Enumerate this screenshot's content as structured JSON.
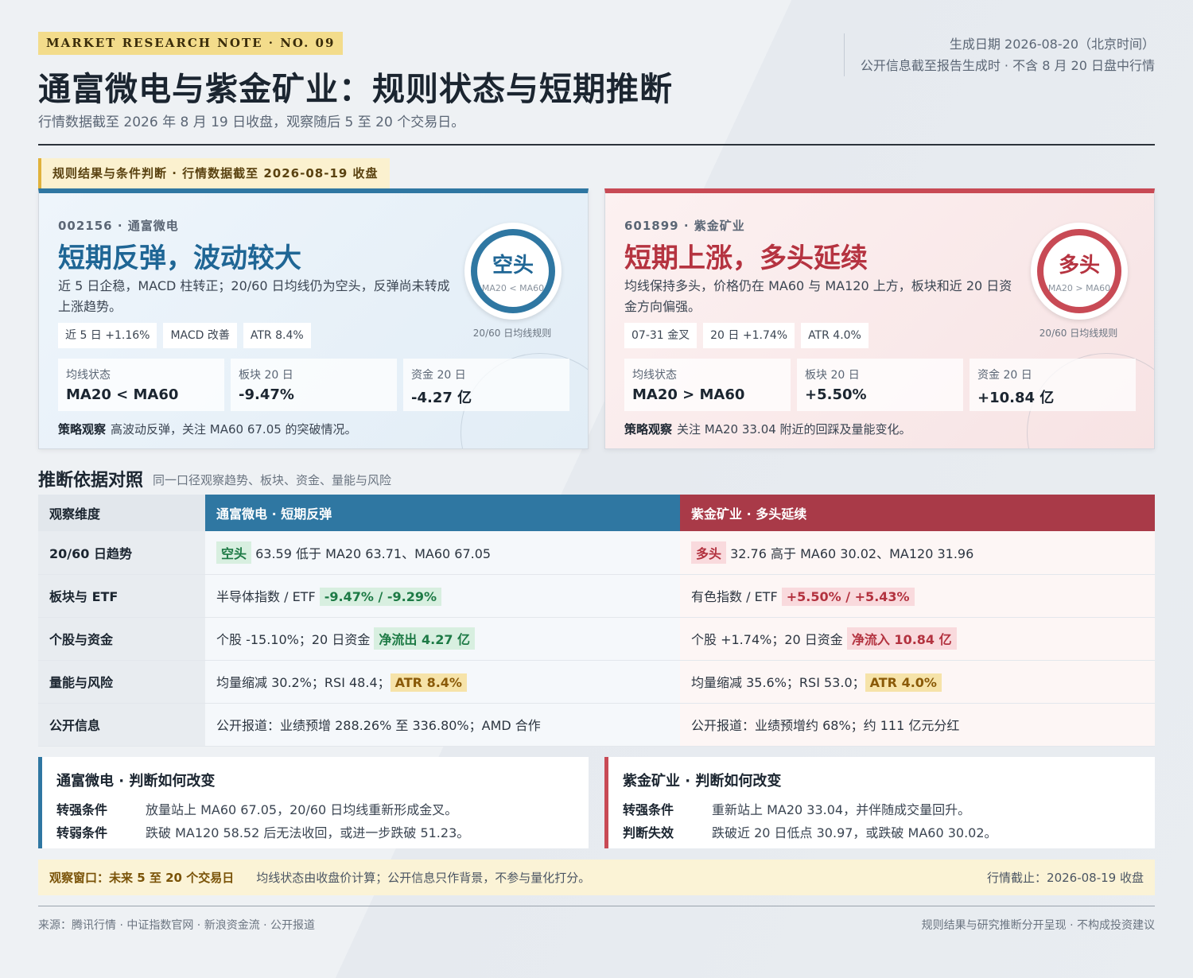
{
  "header": {
    "tag": "MARKET RESEARCH NOTE · NO. 09",
    "title": "通富微电与紫金矿业：规则状态与短期推断",
    "subtitle": "行情数据截至 2026 年 8 月 19 日收盘，观察随后 5 至 20 个交易日。",
    "generated": "生成日期 2026-08-20（北京时间）",
    "cutoff_note": "公开信息截至报告生成时 · 不含 8 月 20 日盘中行情"
  },
  "section_tag": "规则结果与条件判断 · 行情数据截至 2026-08-19 收盘",
  "colors": {
    "blue": "#2f77a2",
    "red": "#c84a55",
    "amber": "#e0b23b"
  },
  "cards": [
    {
      "code": "002156 · 通富微电",
      "headline": "短期反弹，波动较大",
      "desc": "近 5 日企稳，MACD 柱转正；20/60 日均线仍为空头，反弹尚未转成上涨趋势。",
      "chips": [
        "近 5 日 +1.16%",
        "MACD 改善",
        "ATR 8.4%"
      ],
      "badge_word": "空头",
      "badge_sub": "MA20 < MA60",
      "badge_note": "20/60 日均线规则",
      "stats": [
        {
          "k": "均线状态",
          "v": "MA20 < MA60"
        },
        {
          "k": "板块 20 日",
          "v": "-9.47%"
        },
        {
          "k": "资金 20 日",
          "v": "-4.27 亿"
        }
      ],
      "strategy_label": "策略观察",
      "strategy": "高波动反弹，关注 MA60 67.05 的突破情况。"
    },
    {
      "code": "601899 · 紫金矿业",
      "headline": "短期上涨，多头延续",
      "desc": "均线保持多头，价格仍在 MA60 与 MA120 上方，板块和近 20 日资金方向偏强。",
      "chips": [
        "07-31 金叉",
        "20 日 +1.74%",
        "ATR 4.0%"
      ],
      "badge_word": "多头",
      "badge_sub": "MA20 > MA60",
      "badge_note": "20/60 日均线规则",
      "stats": [
        {
          "k": "均线状态",
          "v": "MA20 > MA60"
        },
        {
          "k": "板块 20 日",
          "v": "+5.50%"
        },
        {
          "k": "资金 20 日",
          "v": "+10.84 亿"
        }
      ],
      "strategy_label": "策略观察",
      "strategy": "关注 MA20 33.04 附近的回踩及量能变化。"
    }
  ],
  "comparison": {
    "title": "推断依据对照",
    "subtitle": "同一口径观察趋势、板块、资金、量能与风险",
    "headers": [
      "观察维度",
      "通富微电 · 短期反弹",
      "紫金矿业 · 多头延续"
    ],
    "rows": [
      {
        "dim": "20/60 日趋势",
        "b_pre": "",
        "b_hl": "空头",
        "b_post": " 63.59 低于 MA20 63.71、MA60 67.05",
        "r_pre": "",
        "r_hl": "多头",
        "r_post": " 32.76 高于 MA60 30.02、MA120 31.96"
      },
      {
        "dim": "板块与 ETF",
        "b_pre": "半导体指数 / ETF ",
        "b_hl": "-9.47% / -9.29%",
        "b_post": "",
        "r_pre": "有色指数 / ETF ",
        "r_hl": "+5.50% / +5.43%",
        "r_post": ""
      },
      {
        "dim": "个股与资金",
        "b_pre": "个股 -15.10%；20 日资金 ",
        "b_hl": "净流出 4.27 亿",
        "b_post": "",
        "r_pre": "个股 +1.74%；20 日资金 ",
        "r_hl": "净流入 10.84 亿",
        "r_post": ""
      },
      {
        "dim": "量能与风险",
        "b_pre": "均量缩减 30.2%；RSI 48.4；",
        "b_hl": "ATR 8.4%",
        "b_post": "",
        "r_pre": "均量缩减 35.6%；RSI 53.0；",
        "r_hl": "ATR 4.0%",
        "r_post": ""
      },
      {
        "dim": "公开信息",
        "b_pre": "公开报道：业绩预增 288.26% 至 336.80%；AMD 合作",
        "b_hl": "",
        "b_post": "",
        "r_pre": "公开报道：业绩预增约 68%；约 111 亿元分红",
        "r_hl": "",
        "r_post": ""
      }
    ]
  },
  "changes": [
    {
      "title": "通富微电 · 判断如何改变",
      "rows": [
        {
          "k": "转强条件",
          "v": "放量站上 MA60 67.05，20/60 日均线重新形成金叉。"
        },
        {
          "k": "转弱条件",
          "v": "跌破 MA120 58.52 后无法收回，或进一步跌破 51.23。"
        }
      ]
    },
    {
      "title": "紫金矿业 · 判断如何改变",
      "rows": [
        {
          "k": "转强条件",
          "v": "重新站上 MA20 33.04，并伴随成交量回升。"
        },
        {
          "k": "判断失效",
          "v": "跌破近 20 日低点 30.97，或跌破 MA60 30.02。"
        }
      ]
    }
  ],
  "window": {
    "label": "观察窗口：未来 5 至 20 个交易日",
    "desc": "均线状态由收盘价计算；公开信息只作背景，不参与量化打分。",
    "right": "行情截止：2026-08-19 收盘"
  },
  "footer": {
    "sources": "来源：腾讯行情 · 中证指数官网 · 新浪资金流 · 公开报道",
    "disclaimer": "规则结果与研究推断分开呈现 · 不构成投资建议"
  }
}
